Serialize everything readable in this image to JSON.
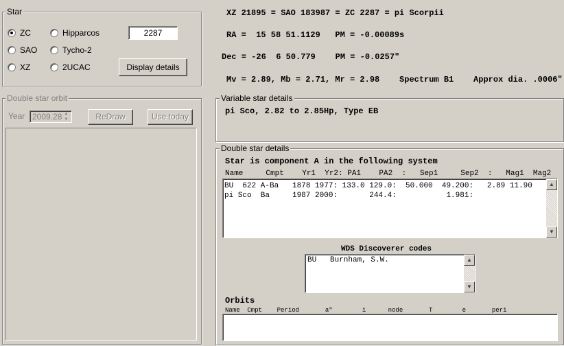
{
  "star_group": {
    "title": "Star",
    "radios": [
      {
        "label": "ZC",
        "selected": true
      },
      {
        "label": "Hipparcos",
        "selected": false
      },
      {
        "label": "SAO",
        "selected": false
      },
      {
        "label": "Tycho-2",
        "selected": false
      },
      {
        "label": "XZ",
        "selected": false
      },
      {
        "label": "2UCAC",
        "selected": false
      }
    ],
    "star_number": "2287",
    "display_details_button": "Display details"
  },
  "summary": {
    "line1": "XZ 21895 = SAO 183987 = ZC 2287 = pi Scorpii",
    "line2": "RA =  15 58 51.1129   PM = -0.00089s",
    "line3": "Dec = -26  6 50.779    PM = -0.0257\"",
    "line4": "Mv = 2.89, Mb = 2.71, Mr = 2.98    Spectrum B1    Approx dia. .0006\""
  },
  "orbit_group": {
    "title": "Double star orbit",
    "year_label": "Year",
    "year_value": "2009.28",
    "redraw_button": "ReDraw",
    "use_today_button": "Use today"
  },
  "variable_group": {
    "title": "Variable star details",
    "text": "pi Sco, 2.82 to 2.85Hp, Type EB"
  },
  "double_group": {
    "title": "Double star details",
    "heading": "Star is component A in the following system",
    "columns_header": "Name     Cmpt    Yr1  Yr2: PA1    PA2  :   Sep1     Sep2  :   Mag1  Mag2",
    "rows": [
      "BU  622 A-Ba   1878 1977: 133.0 129.0:  50.000  49.200:   2.89 11.90",
      "pi Sco  Ba     1987 2000:       244.4:           1.981:"
    ],
    "wds_title": "WDS Discoverer codes",
    "wds_rows": [
      "BU   Burnham, S.W."
    ],
    "orbits_title": "Orbits",
    "orbits_header": "Name  Cmpt    Period       a\"        i      node       T        e       peri"
  },
  "icons": {
    "up": "scroll-up-arrow-icon",
    "down": "scroll-down-arrow-icon"
  }
}
